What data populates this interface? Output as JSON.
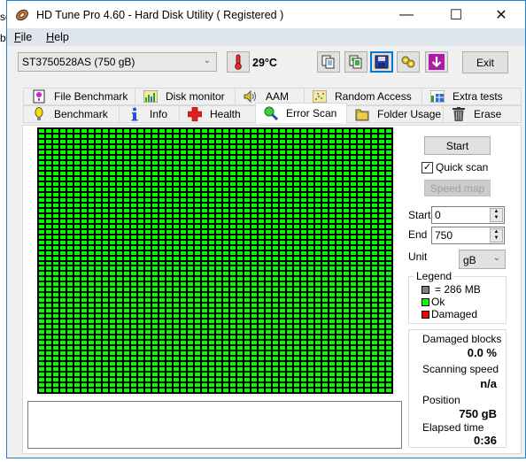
{
  "background": {
    "fragment1": "sc",
    "fragment2": "b"
  },
  "window": {
    "title": "HD Tune Pro 4.60 - Hard Disk Utility ( Registered )",
    "controls": {
      "minimize": "—",
      "maximize": "☐",
      "close": "✕"
    }
  },
  "menu": {
    "file": {
      "accel": "F",
      "rest": "ile"
    },
    "help": {
      "accel": "H",
      "rest": "elp"
    }
  },
  "toolbar": {
    "drive": "ST3750528AS (750 gB)",
    "temperature": "29°C",
    "buttons": [
      "copy-text-icon",
      "copy-screenshot-icon",
      "save-icon",
      "options-icon",
      "download-icon"
    ],
    "exit_label": "Exit"
  },
  "tabs": {
    "row1": [
      "File Benchmark",
      "Disk monitor",
      "AAM",
      "Random Access",
      "Extra tests"
    ],
    "row2": [
      "Benchmark",
      "Info",
      "Health",
      "Error Scan",
      "Folder Usage",
      "Erase"
    ],
    "selected": "Error Scan"
  },
  "scan": {
    "grid_cols": 50,
    "grid_rows": 50,
    "block_status": "ok",
    "colors": {
      "ok": "#00ff00",
      "damaged": "#ff0000",
      "unit": "#808080"
    }
  },
  "controls": {
    "start_label": "Start",
    "quick_scan_label": "Quick scan",
    "quick_scan_checked": true,
    "speed_map_label": "Speed map",
    "start_field_label": "Start",
    "start_value": "0",
    "end_field_label": "End",
    "end_value": "750",
    "unit_label": "Unit",
    "unit_value": "gB"
  },
  "legend": {
    "title": "Legend",
    "unit": "= 286 MB",
    "ok": "Ok",
    "damaged": "Damaged"
  },
  "stats": {
    "damaged_blocks_label": "Damaged blocks",
    "damaged_blocks_value": "0.0 %",
    "scanning_speed_label": "Scanning speed",
    "scanning_speed_value": "n/a",
    "position_label": "Position",
    "position_value": "750 gB",
    "elapsed_label": "Elapsed time",
    "elapsed_value": "0:36"
  }
}
